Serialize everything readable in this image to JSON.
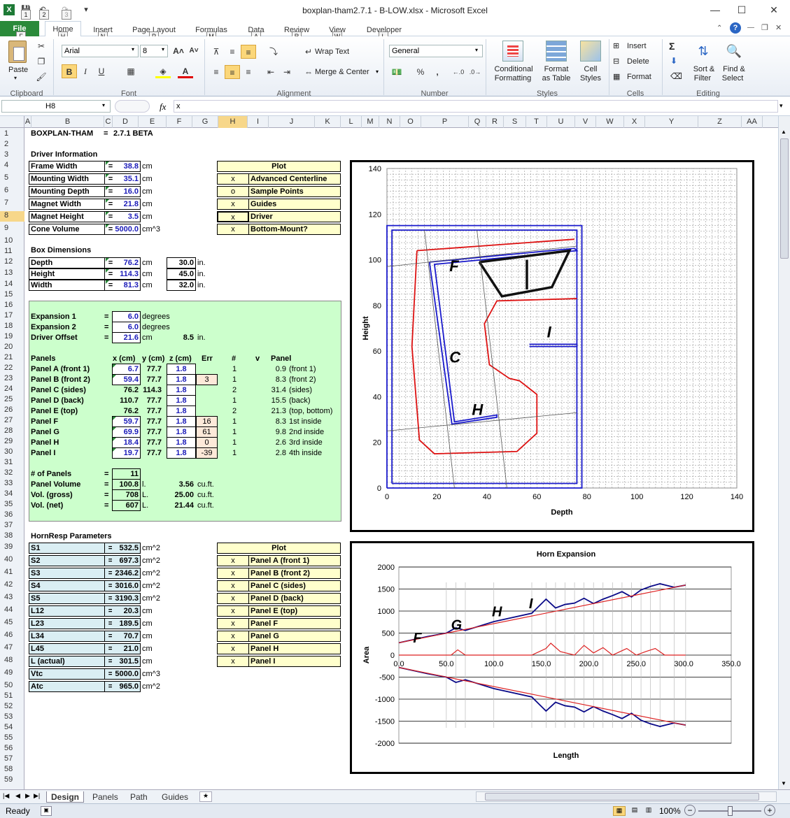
{
  "window": {
    "title": "boxplan-tham2.7.1 - B-LOW.xlsx  -  Microsoft Excel",
    "qat_keys": [
      "1",
      "2",
      "3"
    ]
  },
  "tabs": [
    {
      "label": "File",
      "key": "F"
    },
    {
      "label": "Home",
      "key": "H"
    },
    {
      "label": "Insert",
      "key": "N"
    },
    {
      "label": "Page Layout",
      "key": "P"
    },
    {
      "label": "Formulas",
      "key": "M"
    },
    {
      "label": "Data",
      "key": "A"
    },
    {
      "label": "Review",
      "key": "R"
    },
    {
      "label": "View",
      "key": "W"
    },
    {
      "label": "Developer",
      "key": "L"
    }
  ],
  "ribbon": {
    "paste": "Paste",
    "font_name": "Arial",
    "font_size": "8",
    "wrap_text": "Wrap Text",
    "merge_center": "Merge & Center",
    "number_format": "General",
    "cond_format_1": "Conditional",
    "cond_format_2": "Formatting",
    "format_table_1": "Format",
    "format_table_2": "as Table",
    "cell_styles_1": "Cell",
    "cell_styles_2": "Styles",
    "insert": "Insert",
    "delete": "Delete",
    "format": "Format",
    "sort_1": "Sort &",
    "sort_2": "Filter",
    "find_1": "Find &",
    "find_2": "Select",
    "groups": [
      "Clipboard",
      "Font",
      "Alignment",
      "Number",
      "Styles",
      "Cells",
      "Editing"
    ]
  },
  "formula_bar": {
    "name_box": "H8",
    "fx": "fx",
    "content": "x"
  },
  "columns": [
    "A",
    "B",
    "C",
    "D",
    "E",
    "F",
    "G",
    "H",
    "I",
    "J",
    "K",
    "L",
    "M",
    "N",
    "O",
    "P",
    "Q",
    "R",
    "S",
    "T",
    "U",
    "V",
    "W",
    "X",
    "Y",
    "Z",
    "AA"
  ],
  "rows": [
    "1",
    "2",
    "3",
    "4",
    "5",
    "6",
    "7",
    "8",
    "9",
    "10",
    "11",
    "12",
    "13",
    "14",
    "15",
    "16",
    "17",
    "18",
    "19",
    "20",
    "21",
    "22",
    "23",
    "24",
    "25",
    "26",
    "27",
    "28",
    "29",
    "30",
    "31",
    "32",
    "33",
    "34",
    "35",
    "36",
    "37",
    "38",
    "39",
    "40",
    "41",
    "42",
    "43",
    "44",
    "45",
    "46",
    "47",
    "48",
    "49",
    "50",
    "51",
    "52",
    "53",
    "54",
    "55",
    "56",
    "57",
    "58",
    "59"
  ],
  "header": {
    "app": "BOXPLAN-THAM",
    "eq": "=",
    "version": "2.7.1 BETA"
  },
  "driver": {
    "title": "Driver Information",
    "rows": [
      {
        "label": "Frame Width",
        "value": "38.8",
        "unit": "cm"
      },
      {
        "label": "Mounting Width",
        "value": "35.1",
        "unit": "cm"
      },
      {
        "label": "Mounting Depth",
        "value": "16.0",
        "unit": "cm"
      },
      {
        "label": "Magnet Width",
        "value": "21.8",
        "unit": "cm"
      },
      {
        "label": "Magnet Height",
        "value": "3.5",
        "unit": "cm"
      },
      {
        "label": "Cone Volume",
        "value": "5000.0",
        "unit": "cm^3"
      }
    ]
  },
  "plot1": {
    "title": "Plot",
    "rows": [
      {
        "mark": "x",
        "label": "Advanced Centerline"
      },
      {
        "mark": "o",
        "label": "Sample Points"
      },
      {
        "mark": "x",
        "label": "Guides"
      },
      {
        "mark": "x",
        "label": "Driver"
      },
      {
        "mark": "x",
        "label": "Bottom-Mount?"
      }
    ]
  },
  "box": {
    "title": "Box Dimensions",
    "rows": [
      {
        "label": "Depth",
        "value": "76.2",
        "unit": "cm",
        "inch": "30.0",
        "iunit": "in."
      },
      {
        "label": "Height",
        "value": "114.3",
        "unit": "cm",
        "inch": "45.0",
        "iunit": "in."
      },
      {
        "label": "Width",
        "value": "81.3",
        "unit": "cm",
        "inch": "32.0",
        "iunit": "in."
      }
    ]
  },
  "expansion": [
    {
      "label": "Expansion 1",
      "value": "6.0",
      "unit": "degrees"
    },
    {
      "label": "Expansion 2",
      "value": "6.0",
      "unit": "degrees"
    },
    {
      "label": "Driver Offset",
      "value": "21.6",
      "unit": "cm",
      "extra": "8.5",
      "eunit": "in."
    }
  ],
  "panels": {
    "headers": [
      "Panels",
      "x (cm)",
      "y (cm)",
      "z (cm)",
      "Err",
      "#",
      "v",
      "Panel"
    ],
    "rows": [
      {
        "name": "Panel A (front 1)",
        "x": "6.7",
        "y": "77.7",
        "z": "1.8",
        "err": "",
        "n": "1",
        "v": "0.9",
        "desc": "(front 1)"
      },
      {
        "name": "Panel B (front 2)",
        "x": "59.4",
        "y": "77.7",
        "z": "1.8",
        "err": "3",
        "n": "1",
        "v": "8.3",
        "desc": "(front 2)"
      },
      {
        "name": "Panel C (sides)",
        "x": "76.2",
        "y": "114.3",
        "z": "1.8",
        "err": "",
        "n": "2",
        "v": "31.4",
        "desc": "(sides)"
      },
      {
        "name": "Panel D (back)",
        "x": "110.7",
        "y": "77.7",
        "z": "1.8",
        "err": "",
        "n": "1",
        "v": "15.5",
        "desc": "(back)"
      },
      {
        "name": "Panel E (top)",
        "x": "76.2",
        "y": "77.7",
        "z": "1.8",
        "err": "",
        "n": "2",
        "v": "21.3",
        "desc": "(top, bottom)"
      },
      {
        "name": "Panel F",
        "x": "59.7",
        "y": "77.7",
        "z": "1.8",
        "err": "16",
        "n": "1",
        "v": "8.3",
        "desc": "1st inside"
      },
      {
        "name": "Panel G",
        "x": "69.9",
        "y": "77.7",
        "z": "1.8",
        "err": "61",
        "n": "1",
        "v": "9.8",
        "desc": "2nd inside"
      },
      {
        "name": "Panel H",
        "x": "18.4",
        "y": "77.7",
        "z": "1.8",
        "err": "0",
        "n": "1",
        "v": "2.6",
        "desc": "3rd inside"
      },
      {
        "name": "Panel I",
        "x": "19.7",
        "y": "77.7",
        "z": "1.8",
        "err": "-39",
        "n": "1",
        "v": "2.8",
        "desc": "4th inside"
      }
    ]
  },
  "totals": [
    {
      "label": "# of Panels",
      "value": "11",
      "unit": "",
      "extra": "",
      "eunit": ""
    },
    {
      "label": "Panel Volume",
      "value": "100.8",
      "unit": "l.",
      "extra": "3.56",
      "eunit": "cu.ft."
    },
    {
      "label": "Vol. (gross)",
      "value": "708",
      "unit": "L.",
      "extra": "25.00",
      "eunit": "cu.ft."
    },
    {
      "label": "Vol. (net)",
      "value": "607",
      "unit": "L.",
      "extra": "21.44",
      "eunit": "cu.ft."
    }
  ],
  "hornresp": {
    "title": "HornResp Parameters",
    "rows": [
      {
        "label": "S1",
        "value": "532.5",
        "unit": "cm^2"
      },
      {
        "label": "S2",
        "value": "697.3",
        "unit": "cm^2"
      },
      {
        "label": "S3",
        "value": "2346.2",
        "unit": "cm^2"
      },
      {
        "label": "S4",
        "value": "3016.0",
        "unit": "cm^2"
      },
      {
        "label": "S5",
        "value": "3190.3",
        "unit": "cm^2"
      },
      {
        "label": "L12",
        "value": "20.3",
        "unit": "cm"
      },
      {
        "label": "L23",
        "value": "189.5",
        "unit": "cm"
      },
      {
        "label": "L34",
        "value": "70.7",
        "unit": "cm"
      },
      {
        "label": "L45",
        "value": "21.0",
        "unit": "cm"
      },
      {
        "label": "L (actual)",
        "value": "301.5",
        "unit": "cm"
      },
      {
        "label": "Vtc",
        "value": "5000.0",
        "unit": "cm^3"
      },
      {
        "label": "Atc",
        "value": "965.0",
        "unit": "cm^2"
      }
    ]
  },
  "plot2": {
    "title": "Plot",
    "rows": [
      {
        "mark": "x",
        "label": "Panel A (front 1)"
      },
      {
        "mark": "x",
        "label": "Panel B (front 2)"
      },
      {
        "mark": "x",
        "label": "Panel C (sides)"
      },
      {
        "mark": "x",
        "label": "Panel D (back)"
      },
      {
        "mark": "x",
        "label": "Panel E (top)"
      },
      {
        "mark": "x",
        "label": "Panel F"
      },
      {
        "mark": "x",
        "label": "Panel G"
      },
      {
        "mark": "x",
        "label": "Panel H"
      },
      {
        "mark": "x",
        "label": "Panel I"
      }
    ]
  },
  "chart_data": [
    {
      "type": "line",
      "title": "",
      "xlabel": "Depth",
      "ylabel": "Height",
      "xlim": [
        0,
        140
      ],
      "ylim": [
        0,
        140
      ],
      "xticks": [
        "0",
        "20",
        "40",
        "60",
        "80",
        "100",
        "120",
        "140"
      ],
      "yticks": [
        "0",
        "20",
        "40",
        "60",
        "80",
        "100",
        "120",
        "140"
      ],
      "grid": true,
      "annotations": [
        "F",
        "C",
        "H",
        "I"
      ],
      "series": [
        {
          "color": "#1a1acc",
          "points": [
            [
              2,
              2
            ],
            [
              76,
              2
            ],
            [
              76,
              113
            ],
            [
              2,
              113
            ],
            [
              2,
              2
            ]
          ]
        },
        {
          "color": "#1a1acc",
          "points": [
            [
              0,
              0
            ],
            [
              78,
              0
            ],
            [
              78,
              115
            ],
            [
              0,
              115
            ],
            [
              0,
              0
            ]
          ]
        },
        {
          "color": "#1a1acc",
          "points": [
            [
              17,
              99
            ],
            [
              75,
              105
            ],
            [
              76,
              104
            ],
            [
              19,
              98
            ],
            [
              27,
              29
            ],
            [
              44,
              32
            ],
            [
              44,
              31
            ],
            [
              26,
              28
            ],
            [
              17,
              99
            ]
          ]
        },
        {
          "color": "#1a1acc",
          "points": [
            [
              57,
              62
            ],
            [
              76,
              62
            ],
            [
              76,
              63
            ],
            [
              57,
              63
            ]
          ]
        },
        {
          "color": "#dd1111",
          "points": [
            [
              12,
              104
            ],
            [
              75,
              109
            ]
          ]
        },
        {
          "color": "#dd1111",
          "points": [
            [
              12,
              104
            ],
            [
              10,
              62
            ],
            [
              13,
              21
            ],
            [
              19,
              15
            ],
            [
              52,
              16
            ],
            [
              60,
              24
            ],
            [
              60,
              41
            ],
            [
              53,
              47
            ],
            [
              49,
              48
            ],
            [
              41,
              54
            ],
            [
              39,
              72
            ],
            [
              44,
              82
            ],
            [
              76,
              83
            ]
          ]
        },
        {
          "color": "#111111",
          "points": [
            [
              37,
              99
            ],
            [
              73,
              104
            ],
            [
              66,
              88
            ],
            [
              46,
              84
            ],
            [
              37,
              99
            ]
          ]
        },
        {
          "color": "#111111",
          "points": [
            [
              56,
              100
            ],
            [
              56,
              87
            ]
          ]
        },
        {
          "color": "#555555",
          "points": [
            [
              15,
              113
            ],
            [
              27,
              0
            ]
          ]
        },
        {
          "color": "#555555",
          "points": [
            [
              36,
              113
            ],
            [
              48,
              0
            ]
          ]
        },
        {
          "color": "#555555",
          "points": [
            [
              0,
              97
            ],
            [
              76,
              106
            ]
          ]
        },
        {
          "color": "#555555",
          "points": [
            [
              0,
              25
            ],
            [
              76,
              33
            ]
          ]
        }
      ]
    },
    {
      "type": "line",
      "title": "Horn Expansion",
      "xlabel": "Length",
      "ylabel": "Area",
      "xlim": [
        0,
        350
      ],
      "ylim": [
        -2000,
        2000
      ],
      "xticks": [
        "0.0",
        "50.0",
        "100.0",
        "150.0",
        "200.0",
        "250.0",
        "300.0",
        "350.0"
      ],
      "yticks": [
        "2000",
        "1500",
        "1000",
        "500",
        "0",
        "-500",
        "-1000",
        "-1500",
        "-2000"
      ],
      "annotations": [
        "F",
        "G",
        "H",
        "I"
      ],
      "series": [
        {
          "color": "#0a0a88",
          "x": [
            0,
            30,
            50,
            60,
            70,
            100,
            140,
            155,
            165,
            175,
            185,
            195,
            205,
            215,
            225,
            235,
            245,
            255,
            265,
            275,
            290,
            302
          ],
          "values": [
            280,
            420,
            500,
            620,
            560,
            760,
            950,
            1270,
            1070,
            1150,
            1180,
            1290,
            1170,
            1270,
            1350,
            1440,
            1320,
            1480,
            1560,
            1620,
            1540,
            1590
          ]
        },
        {
          "color": "#0a0a88",
          "x": [
            0,
            30,
            50,
            60,
            70,
            100,
            140,
            155,
            165,
            175,
            185,
            195,
            205,
            215,
            225,
            235,
            245,
            255,
            265,
            275,
            290,
            302
          ],
          "values": [
            -280,
            -420,
            -500,
            -620,
            -560,
            -760,
            -950,
            -1270,
            -1070,
            -1150,
            -1180,
            -1290,
            -1170,
            -1270,
            -1350,
            -1440,
            -1320,
            -1480,
            -1560,
            -1620,
            -1540,
            -1590
          ]
        },
        {
          "color": "#dd2222",
          "x": [
            0,
            302
          ],
          "values": [
            280,
            1590
          ]
        },
        {
          "color": "#dd2222",
          "x": [
            0,
            302
          ],
          "values": [
            -280,
            -1590
          ]
        },
        {
          "color": "#dd2222",
          "x": [
            0,
            55,
            62,
            70,
            140,
            155,
            160,
            170,
            185,
            195,
            205,
            215,
            225,
            240,
            250,
            260,
            270,
            280,
            290,
            302
          ],
          "values": [
            0,
            0,
            120,
            0,
            0,
            150,
            270,
            80,
            0,
            220,
            50,
            170,
            0,
            150,
            0,
            80,
            150,
            0,
            0,
            0
          ]
        }
      ]
    }
  ],
  "sheets": [
    "Design",
    "Panels",
    "Path",
    "Guides"
  ],
  "status": {
    "ready": "Ready",
    "zoom": "100%"
  }
}
